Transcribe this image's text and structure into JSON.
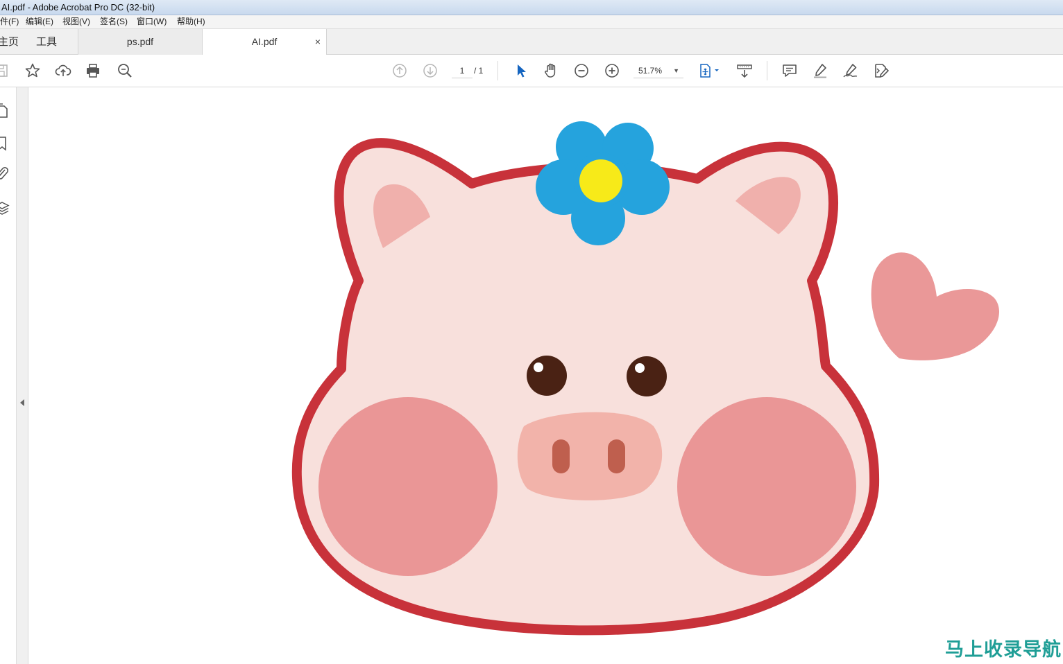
{
  "window": {
    "title": "AI.pdf - Adobe Acrobat Pro DC (32-bit)"
  },
  "menu": {
    "file": "件(F)",
    "edit": "编辑(E)",
    "view": "视图(V)",
    "sign": "签名(S)",
    "window": "窗口(W)",
    "help": "帮助(H)"
  },
  "nav": {
    "home": "主页",
    "tools": "工具"
  },
  "tabs": [
    {
      "label": "ps.pdf"
    },
    {
      "label": "AI.pdf",
      "close": "×"
    }
  ],
  "toolbar": {
    "page_current": "1",
    "page_total": "/ 1",
    "zoom": "51.7%"
  },
  "icons": {
    "save": "save-icon",
    "bookmark": "star-icon",
    "upload": "cloud-upload-icon",
    "print": "print-icon",
    "search": "search-zoom-icon",
    "prev": "page-up-icon",
    "next": "page-down-icon",
    "select": "pointer-icon",
    "hand": "hand-icon",
    "zoom_out": "zoom-out-icon",
    "zoom_in": "zoom-in-icon",
    "fit": "fit-page-icon",
    "scroll": "scroll-mode-icon",
    "comment": "comment-icon",
    "highlight": "highlight-icon",
    "sign": "sign-icon",
    "edit": "edit-pdf-icon"
  },
  "colors": {
    "outline": "#c8323a",
    "face": "#f8e0dc",
    "ear": "#f0b0ac",
    "cheek": "#ea9696",
    "snout": "#f2b3aa",
    "nostril": "#bf5f4e",
    "eye": "#4a2214",
    "petal": "#25a3dd",
    "flower_center": "#f7ea19",
    "heart": "#ea9898",
    "accent_blue": "#1565c0",
    "watermark": "#1f9e96"
  },
  "watermark": "马上收录导航"
}
